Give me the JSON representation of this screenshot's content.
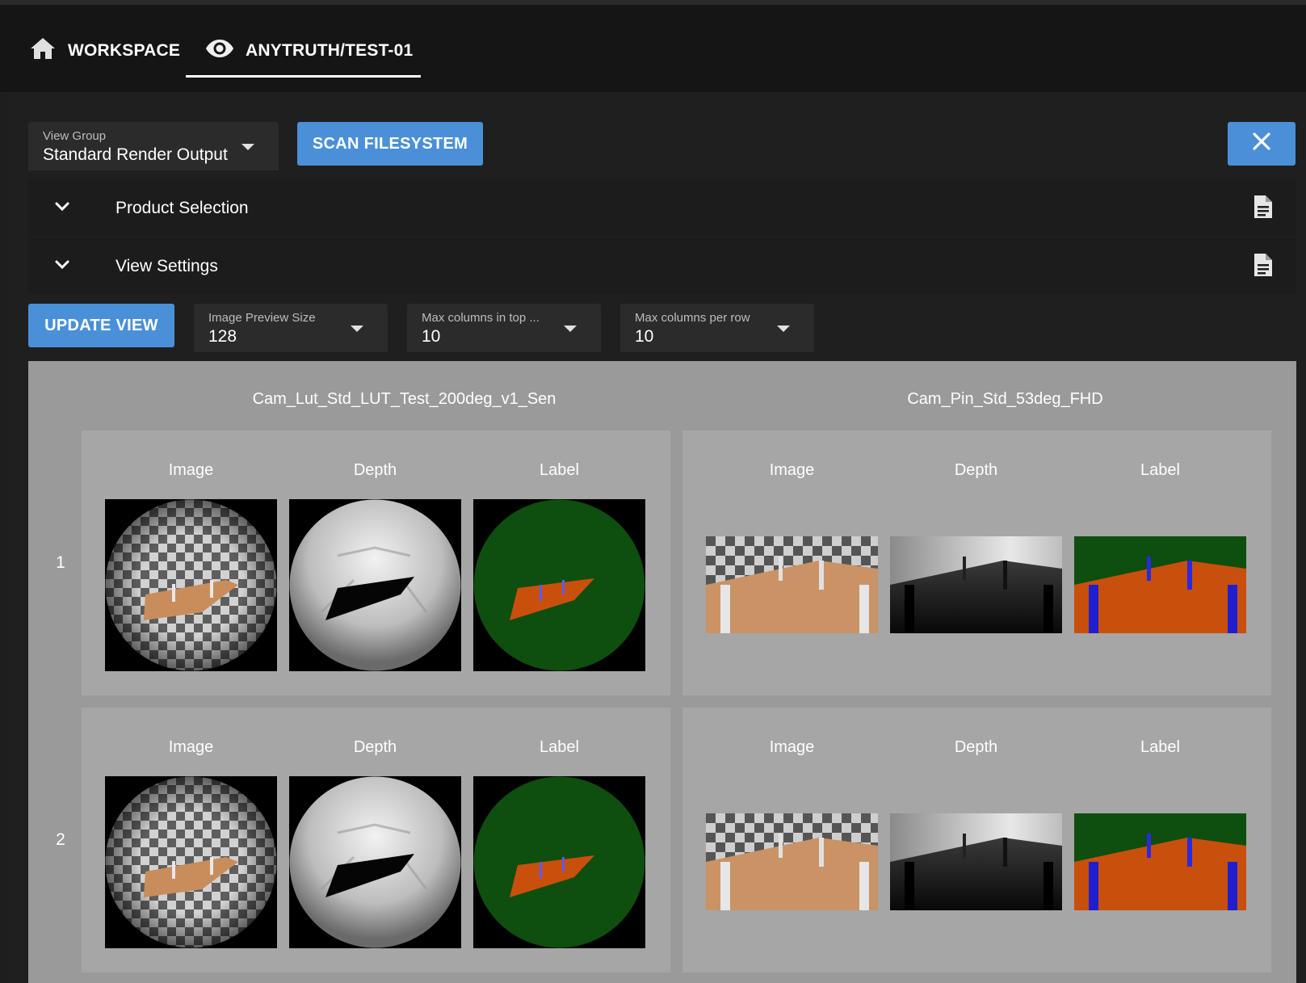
{
  "tabs": [
    {
      "label": "WORKSPACE",
      "icon": "home-icon"
    },
    {
      "label": "ANYTRUTH/TEST-01",
      "icon": "eye-icon",
      "active": true
    }
  ],
  "toolbar": {
    "view_group": {
      "label": "View Group",
      "value": "Standard Render Output"
    },
    "scan_label": "SCAN FILESYSTEM"
  },
  "sections": [
    {
      "title": "Product Selection"
    },
    {
      "title": "View Settings"
    }
  ],
  "view_settings": {
    "update_label": "UPDATE VIEW",
    "preview_size": {
      "label": "Image Preview Size",
      "value": "128"
    },
    "max_top": {
      "label": "Max columns in top ...",
      "value": "10"
    },
    "max_row": {
      "label": "Max columns per row",
      "value": "10"
    }
  },
  "grid": {
    "columns": [
      "Cam_Lut_Std_LUT_Test_200deg_v1_Sen",
      "Cam_Pin_Std_53deg_FHD"
    ],
    "rows": [
      "1",
      "2"
    ],
    "channels": [
      "Image",
      "Depth",
      "Label"
    ]
  },
  "colors": {
    "accent": "#4a90d9",
    "label_green": "#0e4e0e",
    "label_orange": "#c8500c",
    "label_blue": "#1f1fd0",
    "floor_tan": "#c99366"
  }
}
